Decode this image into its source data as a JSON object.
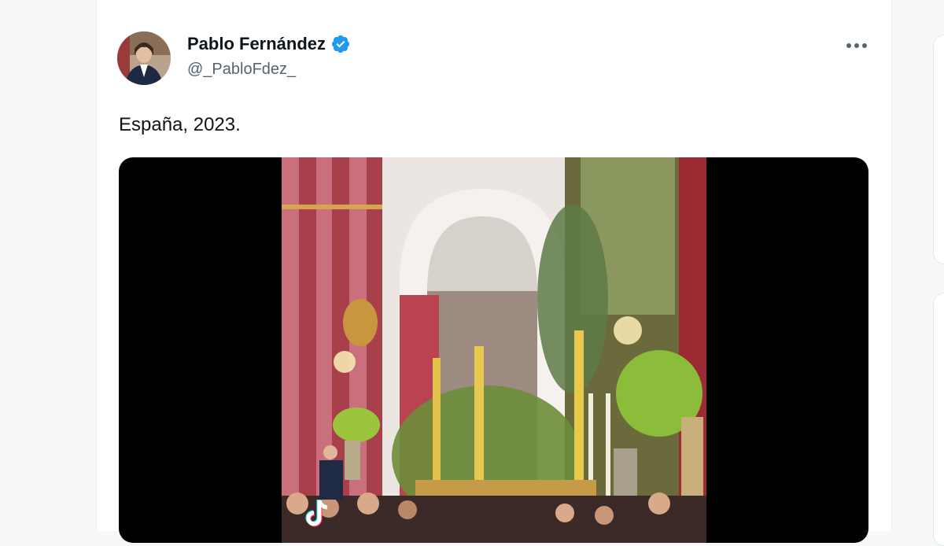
{
  "tweet": {
    "author": {
      "display_name": "Pablo Fernández",
      "handle": "@_PabloFdez_",
      "verified": true,
      "avatar_icon": "profile-photo"
    },
    "text": "España, 2023.",
    "more_icon": "more-horizontal-icon",
    "media": {
      "type": "video",
      "watermark_icon": "tiktok-logo-icon"
    }
  },
  "colors": {
    "verified_blue": "#1d9bf0",
    "text_primary": "#0f1419",
    "text_secondary": "#536471"
  }
}
